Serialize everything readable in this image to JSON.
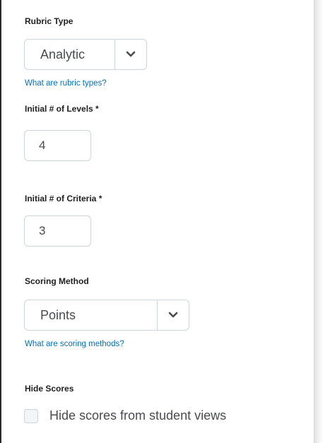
{
  "rubric_type": {
    "label": "Rubric Type",
    "selected": "Analytic",
    "help_link": "What are rubric types?",
    "chevron_icon": "chevron-down-icon"
  },
  "levels": {
    "label": "Initial # of Levels *",
    "value": "4"
  },
  "criteria": {
    "label": "Initial # of Criteria *",
    "value": "3"
  },
  "scoring_method": {
    "label": "Scoring Method",
    "selected": "Points",
    "help_link": "What are scoring methods?",
    "chevron_icon": "chevron-down-icon"
  },
  "hide_scores": {
    "label": "Hide Scores",
    "checkbox_label": "Hide scores from student views",
    "checked": false
  }
}
